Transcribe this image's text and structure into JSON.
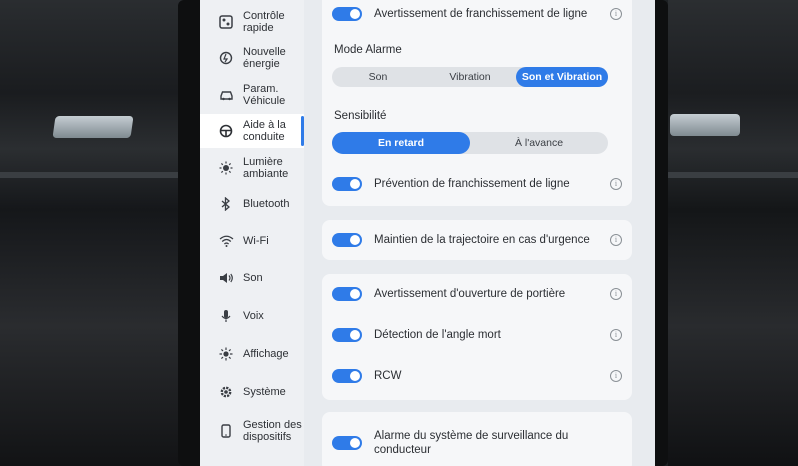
{
  "sidebar": {
    "items": [
      {
        "label": "Contrôle rapide",
        "line1": "Contrôle",
        "line2": "rapide",
        "icon": "quick-control-icon",
        "active": false
      },
      {
        "label": "Nouvelle énergie",
        "line1": "Nouvelle",
        "line2": "énergie",
        "icon": "energy-icon",
        "active": false
      },
      {
        "label": "Param. Véhicule",
        "line1": "Param.",
        "line2": "Véhicule",
        "icon": "car-icon",
        "active": false
      },
      {
        "label": "Aide à la conduite",
        "line1": "Aide à la",
        "line2": "conduite",
        "icon": "steering-wheel-icon",
        "active": true
      },
      {
        "label": "Lumière ambiante",
        "line1": "Lumière",
        "line2": "ambiante",
        "icon": "light-icon",
        "active": false
      },
      {
        "label": "Bluetooth",
        "line1": "Bluetooth",
        "line2": "",
        "icon": "bluetooth-icon",
        "active": false
      },
      {
        "label": "Wi-Fi",
        "line1": "Wi-Fi",
        "line2": "",
        "icon": "wifi-icon",
        "active": false
      },
      {
        "label": "Son",
        "line1": "Son",
        "line2": "",
        "icon": "speaker-icon",
        "active": false
      },
      {
        "label": "Voix",
        "line1": "Voix",
        "line2": "",
        "icon": "microphone-icon",
        "active": false
      },
      {
        "label": "Affichage",
        "line1": "Affichage",
        "line2": "",
        "icon": "brightness-icon",
        "active": false
      },
      {
        "label": "Système",
        "line1": "Système",
        "line2": "",
        "icon": "gear-icon",
        "active": false
      },
      {
        "label": "Gestion des dispositifs",
        "line1": "Gestion des",
        "line2": "dispositifs",
        "icon": "device-icon",
        "active": false
      }
    ]
  },
  "lane_card": {
    "top_toggle_label": "Avertissement de franchissement de ligne",
    "alarm_mode_title": "Mode Alarme",
    "alarm_options": [
      "Son",
      "Vibration",
      "Son et Vibration"
    ],
    "alarm_selected": "Son et Vibration",
    "sensitivity_title": "Sensibilité",
    "sensitivity_options": [
      "En retard",
      "À l'avance"
    ],
    "sensitivity_selected": "En retard",
    "prevention_label": "Prévention de franchissement de ligne"
  },
  "emergency_card": {
    "label": "Maintien de la trajectoire en cas d'urgence"
  },
  "alerts_card": {
    "door_label": "Avertissement d'ouverture de portière",
    "blind_spot_label": "Détection de l'angle mort",
    "rcw_label": "RCW"
  },
  "driver_card": {
    "label_line1": "Alarme du système de surveillance du",
    "label_line2": "conducteur"
  },
  "info_glyph": "i",
  "colors": {
    "accent": "#2f7be8",
    "screen_bg": "#e8ebef",
    "card_bg": "#f6f7f9"
  }
}
